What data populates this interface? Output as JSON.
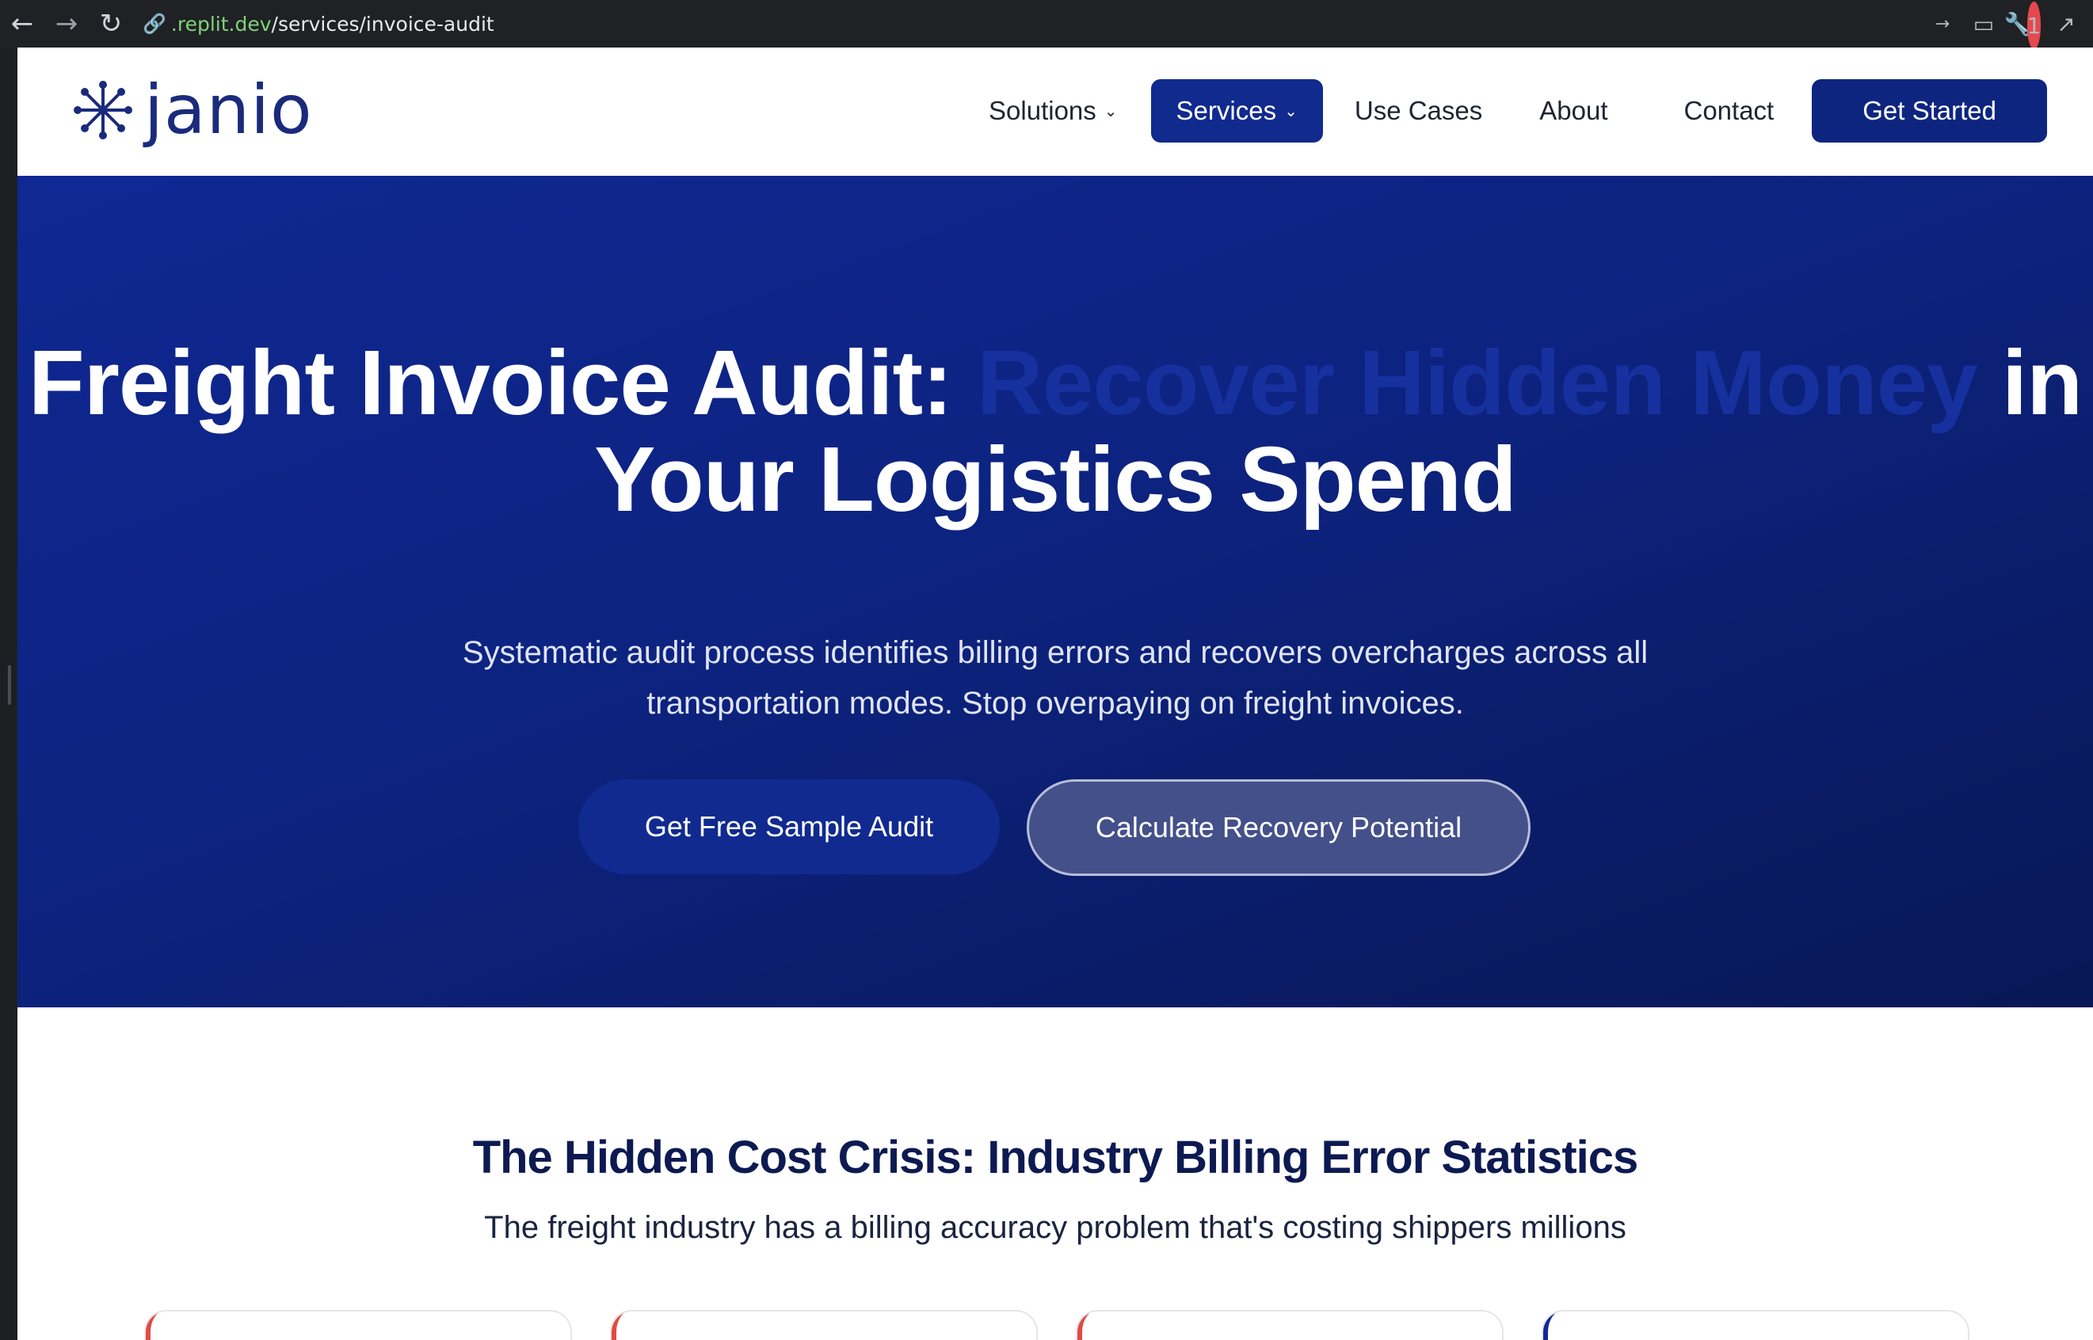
{
  "browser": {
    "url_domain": ".replit.dev",
    "url_path": "/services/invoice-audit",
    "notification_count": "1",
    "icons": [
      "back-icon",
      "forward-icon",
      "reload-icon",
      "link-icon",
      "forward-small-icon",
      "monitor-icon",
      "wrench-icon",
      "external-link-icon"
    ]
  },
  "brand": {
    "name": "janio",
    "primary_color": "#102a8e",
    "accent_color": "#e24a43"
  },
  "nav": {
    "solutions": "Solutions",
    "services": "Services",
    "use_cases": "Use Cases",
    "about": "About",
    "contact": "Contact",
    "cta": "Get Started"
  },
  "hero": {
    "title_part1": "Freight Invoice Audit: ",
    "title_highlight": "Recover Hidden Money",
    "title_part2": " in Your Logistics Spend",
    "subtitle_line1": "Systematic audit process identifies billing errors and recovers overcharges across all",
    "subtitle_line2": "transportation modes. Stop overpaying on freight invoices.",
    "primary_button": "Get Free Sample Audit",
    "secondary_button": "Calculate Recovery Potential"
  },
  "stats": {
    "title": "The Hidden Cost Crisis: Industry Billing Error Statistics",
    "subtitle": "The freight industry has a billing accuracy problem that's costing shippers millions"
  }
}
